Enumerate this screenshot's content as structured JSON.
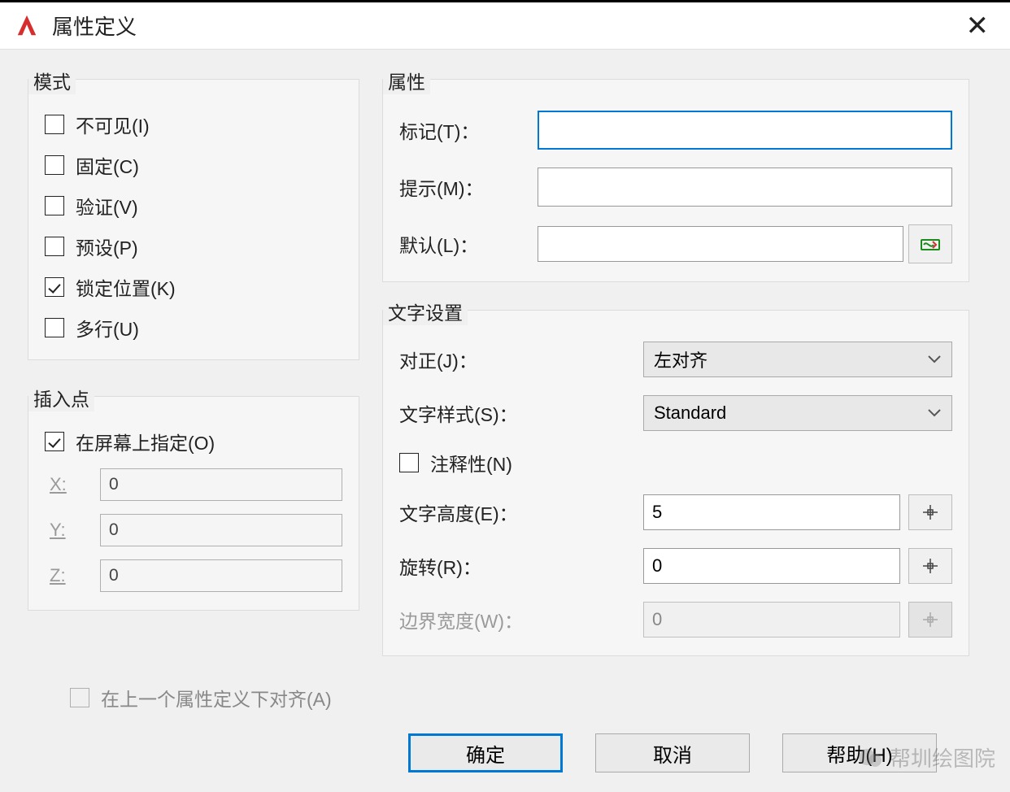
{
  "window_title": "属性定义",
  "mode": {
    "legend": "模式",
    "invisible": "不可见(I)",
    "constant": "固定(C)",
    "verify": "验证(V)",
    "preset": "预设(P)",
    "lock_position": "锁定位置(K)",
    "lock_position_checked": true,
    "multiline": "多行(U)"
  },
  "insert": {
    "legend": "插入点",
    "specify_on_screen": "在屏幕上指定(O)",
    "specify_on_screen_checked": true,
    "x_label": "X:",
    "y_label": "Y:",
    "z_label": "Z:",
    "x": "0",
    "y": "0",
    "z": "0"
  },
  "attr": {
    "legend": "属性",
    "tag_label": "标记(T)：",
    "prompt_label": "提示(M)：",
    "default_label": "默认(L)：",
    "tag": "",
    "prompt": "",
    "default": ""
  },
  "text": {
    "legend": "文字设置",
    "justify_label": "对正(J)：",
    "style_label": "文字样式(S)：",
    "annotative_label": "注释性(N)",
    "height_label": "文字高度(E)：",
    "rotation_label": "旋转(R)：",
    "boundary_label": "边界宽度(W)：",
    "justify": "左对齐",
    "style": "Standard",
    "annotative_checked": false,
    "height": "5",
    "rotation": "0",
    "boundary": "0"
  },
  "align_previous": "在上一个属性定义下对齐(A)",
  "buttons": {
    "ok": "确定",
    "cancel": "取消",
    "help": "帮助(H)"
  },
  "watermark_text": "帮圳绘图院"
}
